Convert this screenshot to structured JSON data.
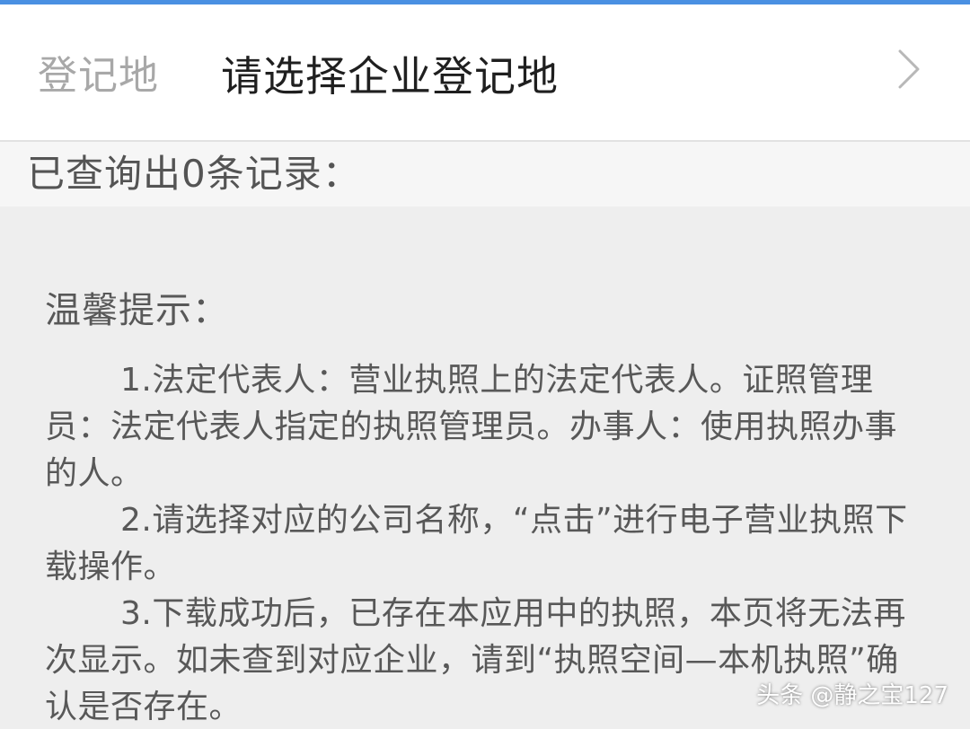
{
  "region": {
    "label": "登记地",
    "placeholder": "请选择企业登记地"
  },
  "results": {
    "count_text": "已查询出0条记录："
  },
  "tips": {
    "title": "温馨提示：",
    "items": [
      "1.法定代表人：营业执照上的法定代表人。证照管理员：法定代表人指定的执照管理员。办事人：使用执照办事的人。",
      "2.请选择对应的公司名称，“点击”进行电子营业执照下载操作。",
      "3.下载成功后，已存在本应用中的执照，本页将无法再次显示。如未查到对应企业，请到“执照空间—本机执照”确认是否存在。"
    ]
  },
  "watermark": "头条 @静之宝127",
  "icons": {
    "region_arrow": "chevron-right-icon"
  },
  "colors": {
    "accent": "#4a90e2",
    "background": "#eeeeee",
    "label_gray": "#a8a8a8",
    "text_dark": "#1f1f1f"
  }
}
